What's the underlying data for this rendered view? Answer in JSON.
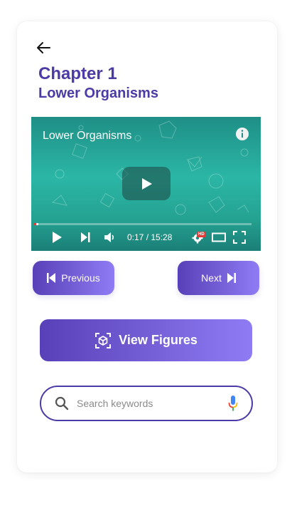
{
  "header": {
    "chapter_title": "Chapter 1",
    "chapter_subtitle": "Lower Organisms"
  },
  "video": {
    "title": "Lower Organisms",
    "current_time": "0:17",
    "separator": " / ",
    "duration": "15:28",
    "hd_badge": "HD",
    "progress_fraction": 0.018
  },
  "navigation": {
    "previous_label": "Previous",
    "next_label": "Next"
  },
  "figures": {
    "button_label": "View Figures"
  },
  "search": {
    "placeholder": "Search keywords"
  },
  "colors": {
    "accent": "#4a3ba6",
    "gradient_start": "#5840b8",
    "gradient_end": "#8f7cf4",
    "video_teal": "#2bb6a5",
    "progress_red": "#e53935"
  }
}
